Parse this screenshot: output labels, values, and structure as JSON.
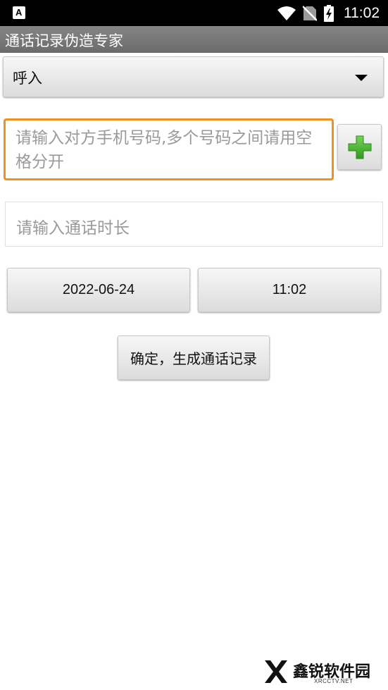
{
  "status_bar": {
    "time": "11:02",
    "icons": [
      "notification-a-icon",
      "wifi-icon",
      "no-sim-icon",
      "battery-charging-icon"
    ]
  },
  "app": {
    "title": "通话记录伪造专家"
  },
  "call_type": {
    "selected": "呼入"
  },
  "phone_input": {
    "placeholder": "请输入对方手机号码,多个号码之间请用空格分开",
    "value": ""
  },
  "add_button": {
    "icon": "plus-icon",
    "color": "#3fae29"
  },
  "duration_input": {
    "placeholder": "请输入通话时长",
    "value": ""
  },
  "date_button": {
    "label": "2022-06-24"
  },
  "time_button": {
    "label": "11:02"
  },
  "generate_button": {
    "label": "确定，生成通话记录"
  },
  "watermark": {
    "text": "鑫锐软件园",
    "subtext": "XRCCTV.NET"
  },
  "colors": {
    "status_bar": "#000000",
    "title_bar": "#777777",
    "focus_border": "#f0901e",
    "placeholder": "#9a9a9a"
  }
}
